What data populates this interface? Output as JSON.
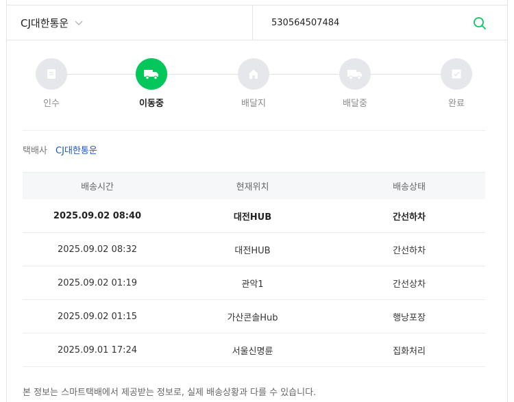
{
  "search": {
    "carrier": "CJ대한통운",
    "tracking_number": "530564507484"
  },
  "steps": [
    {
      "label": "인수",
      "icon": "document-icon",
      "active": false
    },
    {
      "label": "이동중",
      "icon": "truck-icon",
      "active": true
    },
    {
      "label": "배달지",
      "icon": "house-icon",
      "active": false
    },
    {
      "label": "배달중",
      "icon": "delivery-truck-icon",
      "active": false
    },
    {
      "label": "완료",
      "icon": "check-box-icon",
      "active": false
    }
  ],
  "company": {
    "label": "택배사",
    "name": "CJ대한통운"
  },
  "table": {
    "headers": [
      "배송시간",
      "현재위치",
      "배송상태"
    ],
    "rows": [
      [
        "2025.09.02 08:40",
        "대전HUB",
        "간선하차"
      ],
      [
        "2025.09.02 08:32",
        "대전HUB",
        "간선하차"
      ],
      [
        "2025.09.02 01:19",
        "관악1",
        "간선상차"
      ],
      [
        "2025.09.02 01:15",
        "가산콘솔Hub",
        "행낭포장"
      ],
      [
        "2025.09.01 17:24",
        "서울신명륜",
        "집화처리"
      ]
    ]
  },
  "notice": "본 정보는 스마트택배에서 제공받는 정보로, 실제 배송상황과 다를 수 있습니다.",
  "colors": {
    "accent": "#03c75a",
    "link": "#1a56c2",
    "step_inactive": "#e5e7ea"
  }
}
